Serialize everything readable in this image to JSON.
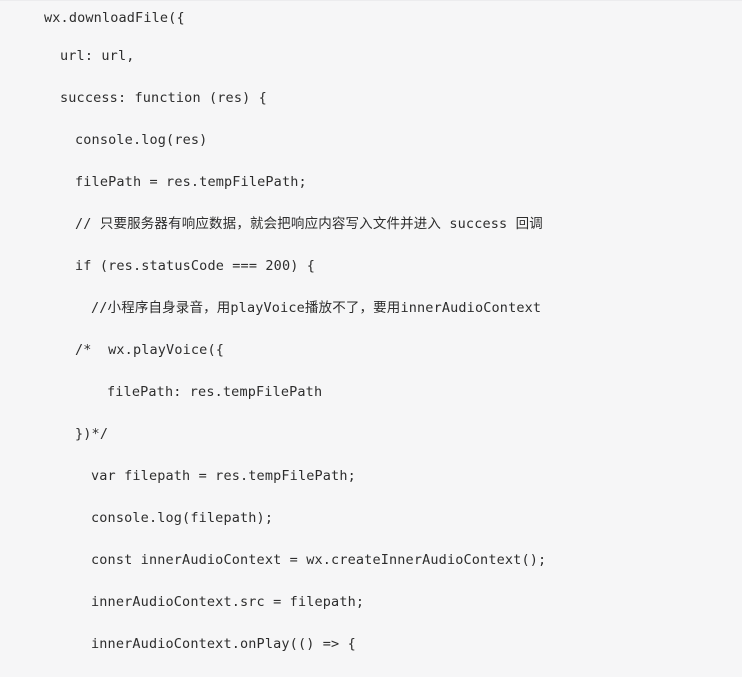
{
  "document": {
    "background_color": "#f6f6f7",
    "text_color": "#2d2d2d",
    "language": "javascript",
    "lines": [
      {
        "indent": 0,
        "text": "wx.downloadFile({"
      },
      {
        "indent": 1,
        "text": "url: url,"
      },
      {
        "indent": 1,
        "text": "success: function (res) {"
      },
      {
        "indent": 2,
        "text": "console.log(res)"
      },
      {
        "indent": 2,
        "text": "filePath = res.tempFilePath;"
      },
      {
        "indent": 2,
        "text": "// 只要服务器有响应数据，就会把响应内容写入文件并进入 success 回调"
      },
      {
        "indent": 2,
        "text": "if (res.statusCode === 200) {"
      },
      {
        "indent": 3,
        "text": "//小程序自身录音，用playVoice播放不了，要用innerAudioContext"
      },
      {
        "indent": 2,
        "text": "/*  wx.playVoice({"
      },
      {
        "indent": 4,
        "text": "filePath: res.tempFilePath"
      },
      {
        "indent": 2,
        "text": "})*/"
      },
      {
        "indent": 3,
        "text": "var filepath = res.tempFilePath;"
      },
      {
        "indent": 3,
        "text": "console.log(filepath);"
      },
      {
        "indent": 3,
        "text": "const innerAudioContext = wx.createInnerAudioContext();"
      },
      {
        "indent": 3,
        "text": "innerAudioContext.src = filepath;"
      },
      {
        "indent": 3,
        "text": "innerAudioContext.onPlay(() => {"
      }
    ]
  }
}
